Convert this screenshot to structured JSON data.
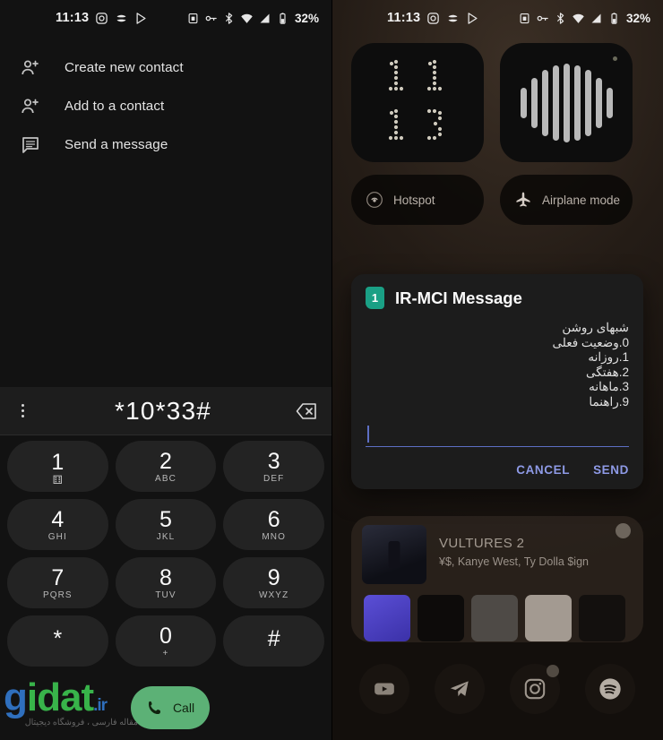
{
  "left_panel": {
    "status_bar": {
      "time": "11:13",
      "app_icons": [
        "instagram-icon",
        "swirl-app-icon",
        "play-store-icon"
      ],
      "system_icons": [
        "rotation-lock-icon",
        "vpn-key-icon",
        "bluetooth-icon",
        "wifi-icon",
        "cellular-signal-icon",
        "battery-icon"
      ],
      "battery_level": "32%"
    },
    "contact_actions": [
      {
        "icon": "person-add-icon",
        "label": "Create new contact"
      },
      {
        "icon": "person-add-icon",
        "label": "Add to a contact"
      },
      {
        "icon": "message-icon",
        "label": "Send a message"
      }
    ],
    "dialer": {
      "overflow_icon": "more-vert-icon",
      "number": "*10*33#",
      "backspace_icon": "backspace-icon",
      "keys": [
        {
          "digit": "1",
          "sub": "⚅",
          "sub_class": "vm"
        },
        {
          "digit": "2",
          "sub": "ABC",
          "sub_class": ""
        },
        {
          "digit": "3",
          "sub": "DEF",
          "sub_class": ""
        },
        {
          "digit": "4",
          "sub": "GHI",
          "sub_class": ""
        },
        {
          "digit": "5",
          "sub": "JKL",
          "sub_class": ""
        },
        {
          "digit": "6",
          "sub": "MNO",
          "sub_class": ""
        },
        {
          "digit": "7",
          "sub": "PQRS",
          "sub_class": ""
        },
        {
          "digit": "8",
          "sub": "TUV",
          "sub_class": ""
        },
        {
          "digit": "9",
          "sub": "WXYZ",
          "sub_class": ""
        },
        {
          "digit": "*",
          "sub": "",
          "sub_class": ""
        },
        {
          "digit": "0",
          "sub": "+",
          "sub_class": ""
        },
        {
          "digit": "#",
          "sub": "",
          "sub_class": ""
        }
      ],
      "call_label": "Call",
      "call_icon": "phone-icon",
      "call_color": "#5cb176"
    },
    "watermark": {
      "brand_first": "g",
      "brand_rest": "idat",
      "tld": ".ir",
      "subtitle": "مقاله فارسی ، فروشگاه دیجیتال",
      "color_primary": "#2f6fbd",
      "color_secondary": "#38b34a"
    }
  },
  "right_panel": {
    "status_bar": {
      "time": "11:13",
      "battery_level": "32%"
    },
    "widgets": [
      {
        "name": "dotted-clock-widget",
        "line1": "11",
        "line2": "13"
      },
      {
        "name": "sound-visualizer-widget",
        "label": ""
      }
    ],
    "toggles": [
      {
        "icon": "hotspot-icon",
        "label": "Hotspot"
      },
      {
        "icon": "airplane-icon",
        "label": "Airplane mode"
      }
    ],
    "dialog": {
      "sim_number": "1",
      "title": "IR-MCI Message",
      "lines": [
        "شبهای روشن",
        "0.وضعیت فعلی",
        "1.روزانه",
        "2.هفتگی",
        "3.ماهانه",
        "9.راهنما"
      ],
      "input_value": "",
      "input_placeholder": "",
      "cancel_label": "CANCEL",
      "send_label": "SEND",
      "action_color": "#8e9ae6",
      "sim_badge_color": "#1aa085"
    },
    "spotify": {
      "track_title": "VULTURES 2",
      "artists": "¥$, Kanye West, Ty Dolla $ign",
      "logo_icon": "spotify-icon",
      "shortcuts": [
        "liked-songs-tile",
        "dark-album-tile",
        "grey-album-tile",
        "novel-album-tile",
        "dark-art-tile"
      ]
    },
    "dock": [
      {
        "icon": "youtube-icon",
        "badge": false
      },
      {
        "icon": "telegram-icon",
        "badge": false
      },
      {
        "icon": "instagram-icon",
        "badge": true
      },
      {
        "icon": "spotify-icon",
        "badge": false
      }
    ]
  }
}
